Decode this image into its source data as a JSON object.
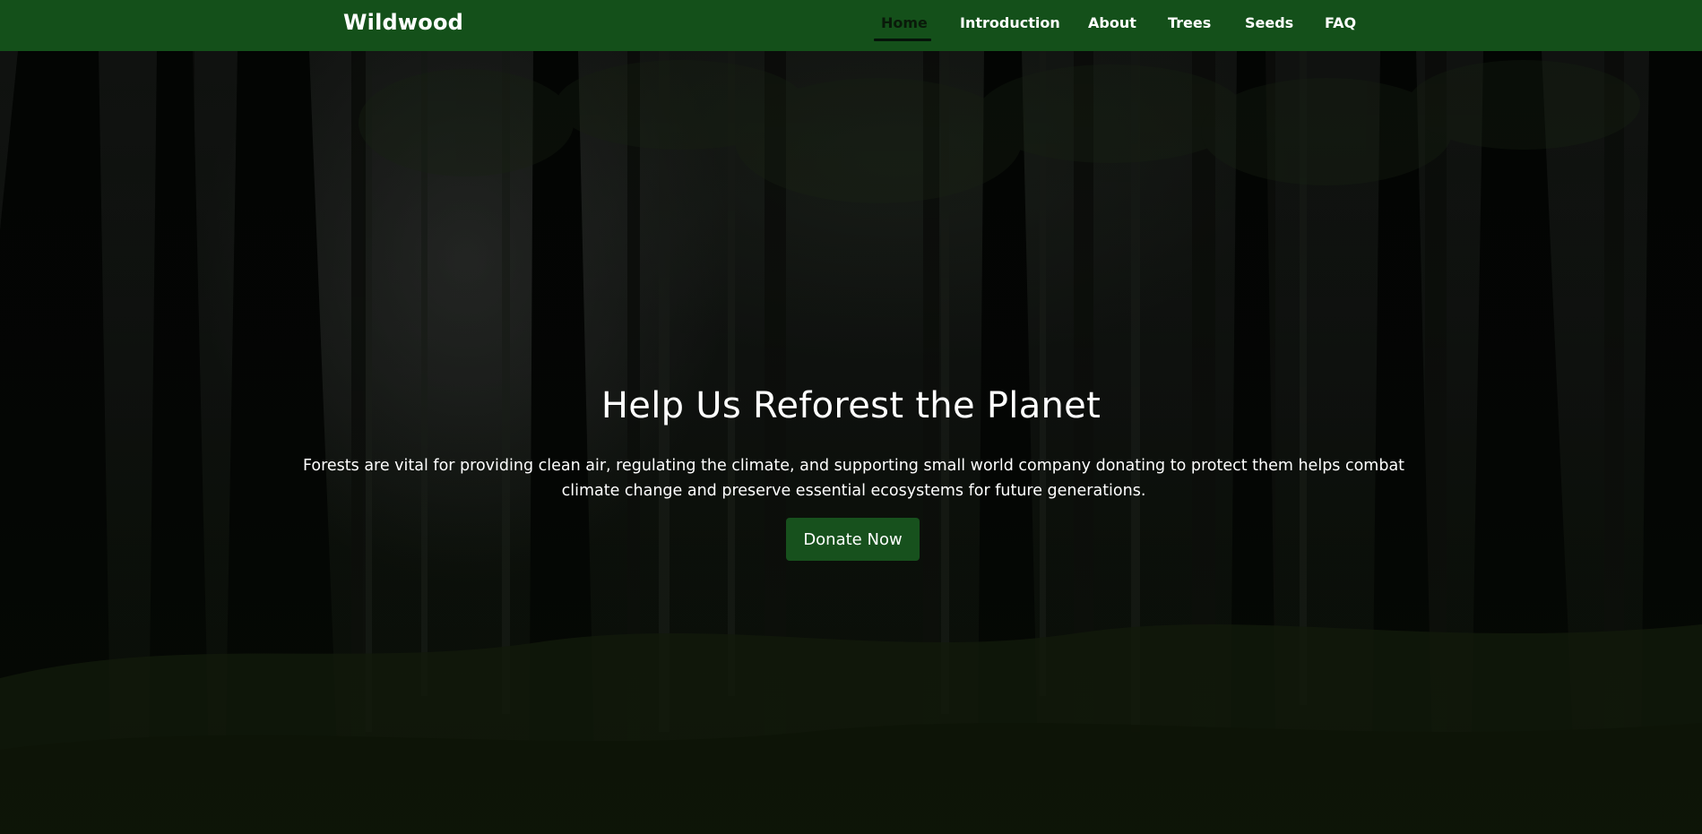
{
  "navbar": {
    "brand": "Wildwood",
    "items": [
      {
        "label": "Home",
        "active": true
      },
      {
        "label": "Introduction",
        "active": false
      },
      {
        "label": "About",
        "active": false
      },
      {
        "label": "Trees",
        "active": false
      },
      {
        "label": "Seeds",
        "active": false
      },
      {
        "label": "FAQ",
        "active": false
      }
    ]
  },
  "hero": {
    "title": "Help Us Reforest the Planet",
    "description": "Forests are vital for providing clean air, regulating the climate, and supporting small world company donating to protect them helps combat climate change and preserve essential ecosystems for future generations.",
    "cta_label": "Donate Now",
    "background_image": "dark-forest-photo"
  },
  "colors": {
    "navbar_bg": "#14501a",
    "button_bg": "#17511d",
    "text": "#ffffff"
  }
}
